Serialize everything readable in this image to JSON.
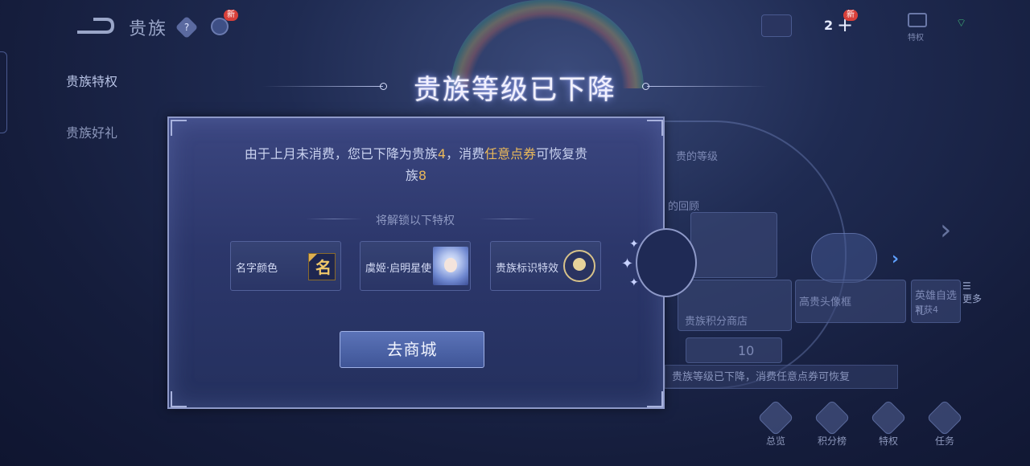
{
  "header": {
    "title": "贵族",
    "help_icon": "?",
    "new_badge": "新",
    "currency_count": "2",
    "currency_plus": "+",
    "currency_new_badge": "新",
    "mail_label": "特权"
  },
  "sidebar": {
    "items": [
      {
        "label": "贵族特权"
      },
      {
        "label": "贵族好礼"
      }
    ]
  },
  "background": {
    "label_level": "贵的等级",
    "label_sub": "的回顾",
    "tile_center": "贵族积分商店",
    "tile_frame": "高贵头像框",
    "tile_hero": "英雄自选礼",
    "tile_hero_sub": "可获4",
    "more_label": "更多",
    "counter_value": "10",
    "notice": "贵族等级已下降，消费任意点券可恢复"
  },
  "bottom_nav": [
    {
      "label": "总览"
    },
    {
      "label": "积分榜"
    },
    {
      "label": "特权"
    },
    {
      "label": "任务"
    }
  ],
  "dialog": {
    "title": "贵族等级已下降",
    "message_part1": "由于上月未消费，您已下降为贵族",
    "message_level_current": "4",
    "message_part2": "，消费",
    "message_highlight": "任意点券",
    "message_part3": "可恢复贵",
    "message_part4": "族",
    "message_level_target": "8",
    "unlock_heading": "将解锁以下特权",
    "privileges": [
      {
        "label": "名字颜色",
        "icon": "name-color-icon",
        "icon_text": "名"
      },
      {
        "label": "虞姬·启明星使",
        "icon": "hero-skin-avatar"
      },
      {
        "label": "贵族标识特效",
        "icon": "noble-emblem-icon"
      }
    ],
    "button_label": "去商城"
  },
  "colors": {
    "highlight": "#e9b85a",
    "button": "#4a62a8",
    "badge": "#d8403a"
  }
}
